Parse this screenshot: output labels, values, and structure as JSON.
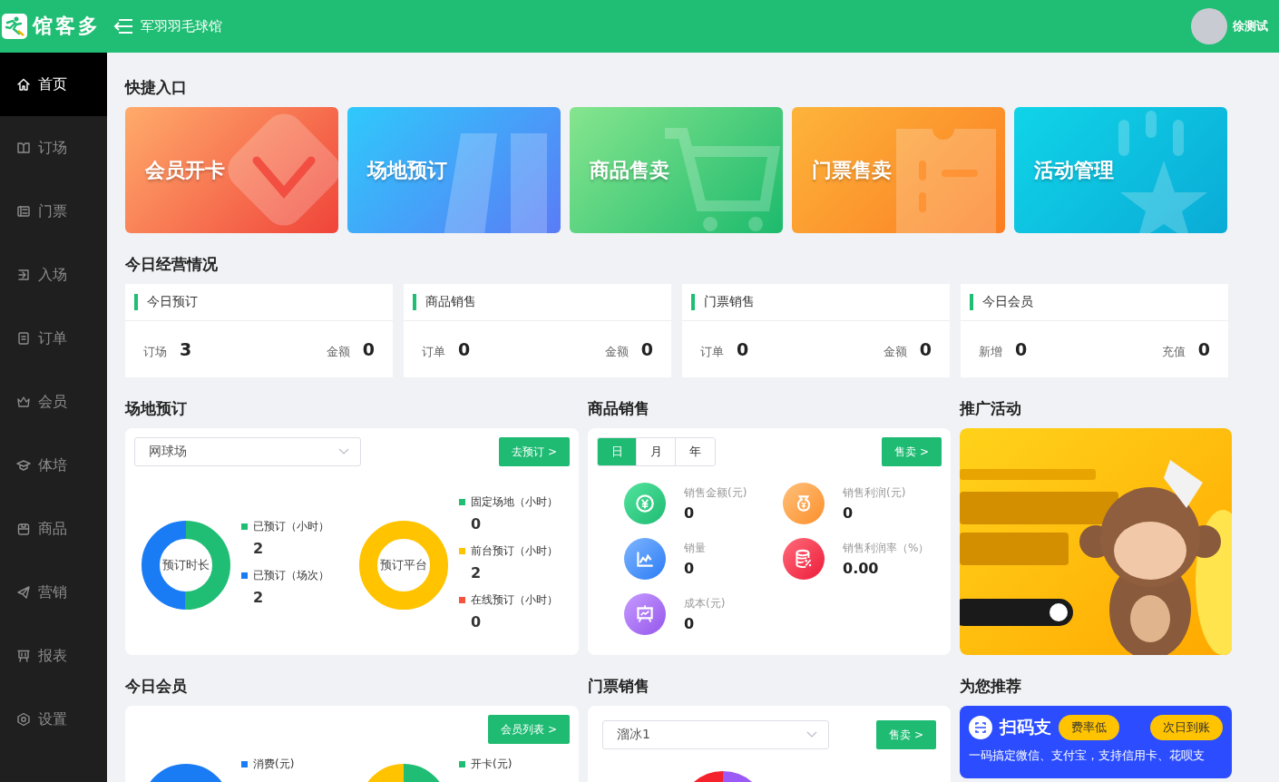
{
  "header": {
    "logo": "馆客多",
    "venue": "军羽羽毛球馆",
    "user": "徐测试"
  },
  "sidebar": {
    "items": [
      {
        "label": "首页",
        "selected": true
      },
      {
        "label": "订场",
        "selected": false
      },
      {
        "label": "门票",
        "selected": false
      },
      {
        "label": "入场",
        "selected": false
      },
      {
        "label": "订单",
        "selected": false
      },
      {
        "label": "会员",
        "selected": false
      },
      {
        "label": "体培",
        "selected": false
      },
      {
        "label": "商品",
        "selected": false
      },
      {
        "label": "营销",
        "selected": false
      },
      {
        "label": "报表",
        "selected": false
      },
      {
        "label": "设置",
        "selected": false
      }
    ]
  },
  "shortcuts": {
    "title": "快捷入口",
    "items": [
      {
        "label": "会员开卡"
      },
      {
        "label": "场地预订"
      },
      {
        "label": "商品售卖"
      },
      {
        "label": "门票售卖"
      },
      {
        "label": "活动管理"
      }
    ]
  },
  "today": {
    "title": "今日经营情况",
    "cards": [
      {
        "title": "今日预订",
        "stats": [
          {
            "label": "订场",
            "value": "3"
          },
          {
            "label": "金额",
            "value": "0"
          }
        ]
      },
      {
        "title": "商品销售",
        "stats": [
          {
            "label": "订单",
            "value": "0"
          },
          {
            "label": "金额",
            "value": "0"
          }
        ]
      },
      {
        "title": "门票销售",
        "stats": [
          {
            "label": "订单",
            "value": "0"
          },
          {
            "label": "金额",
            "value": "0"
          }
        ]
      },
      {
        "title": "今日会员",
        "stats": [
          {
            "label": "新增",
            "value": "0"
          },
          {
            "label": "充值",
            "value": "0"
          }
        ]
      }
    ]
  },
  "venue_booking": {
    "title": "场地预订",
    "select": "网球场",
    "button": "去预订 >",
    "donuts": [
      {
        "center": "预订时长",
        "legend": [
          {
            "label": "已预订（小时）",
            "value": "2",
            "color": "#20be74"
          },
          {
            "label": "已预订（场次）",
            "value": "2",
            "color": "#1a7cf5"
          }
        ]
      },
      {
        "center": "预订平台",
        "legend": [
          {
            "label": "固定场地（小时）",
            "value": "0",
            "color": "#20be74"
          },
          {
            "label": "前台预订（小时）",
            "value": "2",
            "color": "#ffc300"
          },
          {
            "label": "在线预订（小时）",
            "value": "0",
            "color": "#f5533d"
          }
        ]
      }
    ]
  },
  "goods_sales": {
    "title": "商品销售",
    "periods": [
      {
        "label": "日",
        "selected": true
      },
      {
        "label": "月",
        "selected": false
      },
      {
        "label": "年",
        "selected": false
      }
    ],
    "button": "售卖 >",
    "metrics": [
      {
        "label": "销售金额(元)",
        "value": "0"
      },
      {
        "label": "销售利润(元)",
        "value": "0"
      },
      {
        "label": "销量",
        "value": "0"
      },
      {
        "label": "销售利润率（%）",
        "value": "0.00"
      },
      {
        "label": "成本(元)",
        "value": "0"
      }
    ]
  },
  "promotion": {
    "title": "推广活动"
  },
  "today_members": {
    "title": "今日会员",
    "button": "会员列表 >",
    "donuts": [
      {
        "segments": [
          {
            "color": "#1a7cf5"
          }
        ],
        "legend": [
          {
            "label": "消费(元)",
            "color": "#1a7cf5"
          }
        ]
      },
      {
        "segments": [
          {
            "color": "#20be74"
          },
          {
            "color": "#ffc300"
          }
        ],
        "legend": [
          {
            "label": "开卡(元)",
            "color": "#20be74"
          }
        ]
      }
    ]
  },
  "ticket_sales": {
    "title": "门票销售",
    "select": "溜冰1",
    "button": "售卖 >",
    "donut": {
      "segments": [
        {
          "color": "#9b59f5"
        },
        {
          "color": "#f5222d"
        }
      ]
    }
  },
  "recommend": {
    "title": "为您推荐",
    "card": {
      "title": "扫码支",
      "tags": [
        "费率低",
        "次日到账"
      ],
      "text": "一码搞定微信、支付宝，支持信用卡、花呗支"
    }
  }
}
